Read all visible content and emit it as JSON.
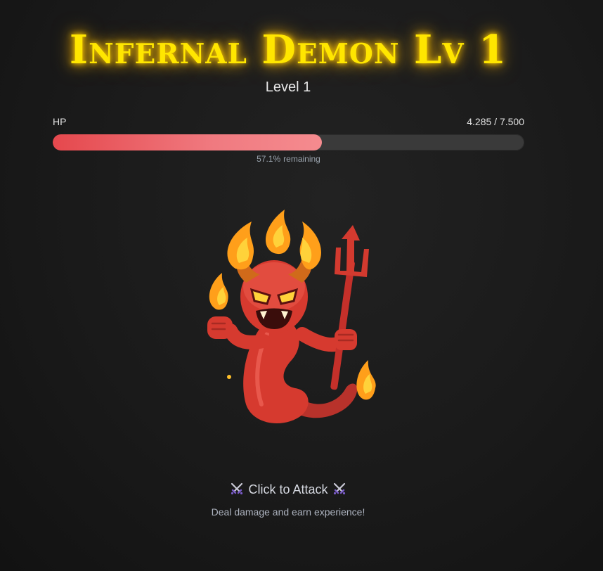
{
  "boss": {
    "name": "Infernal Demon Lv 1",
    "level_label": "Level 1"
  },
  "hp": {
    "label": "HP",
    "current": "4.285",
    "max": "7.500",
    "separator": " / ",
    "fraction": 0.5713,
    "remaining_percent": "57.1%",
    "remaining_suffix": "remaining"
  },
  "attack": {
    "label": "Click to Attack",
    "icon": "crossed-swords-icon",
    "hint": "Deal damage and earn experience!"
  },
  "colors": {
    "title": "#ffe600",
    "hp_fill": "#e5484d",
    "hp_track": "#3a3a3a",
    "demon_body": "#d63a2f",
    "flame": "#ffb21f"
  }
}
